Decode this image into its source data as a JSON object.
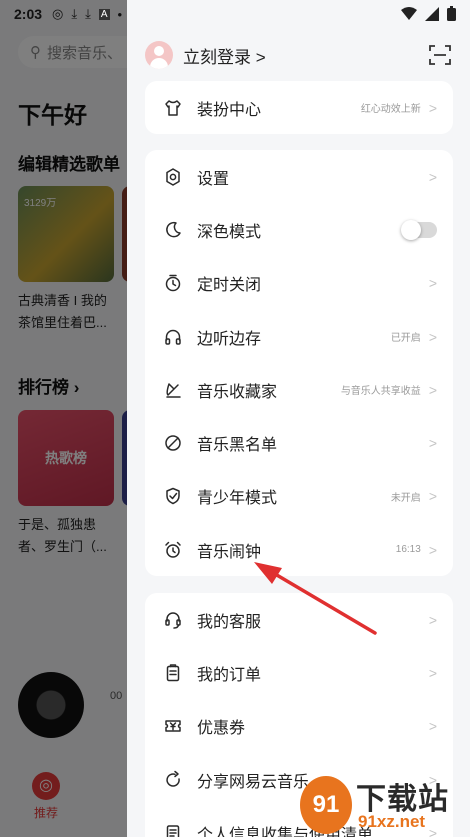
{
  "status_bar": {
    "time": "2:03",
    "left_icons": [
      "netease-icon",
      "download-icon",
      "download-icon",
      "a-icon",
      "dot-icon"
    ],
    "right_icons": [
      "wifi-icon",
      "signal-icon",
      "battery-icon"
    ]
  },
  "background": {
    "search_placeholder": "搜索音乐、",
    "greeting": "下午好",
    "section_editor": "编辑精选歌单",
    "playlist_count": "3129万",
    "playlist_caption": "古典清香 I 我的茶馆里住着巴...",
    "section_chart": "排行榜",
    "chart_badge": "热歌榜",
    "chart_caption": "于是、孤独患者、罗生门（...",
    "player_time": "00",
    "nav_label": "推荐"
  },
  "drawer": {
    "login_label": "立刻登录",
    "login_chevron": ">",
    "card1": [
      {
        "name": "dress-up",
        "icon": "shirt-icon",
        "label": "装扮中心",
        "value": "红心动效上新",
        "chevron": ">"
      }
    ],
    "card2": [
      {
        "name": "settings",
        "icon": "gear-icon",
        "label": "设置",
        "value": "",
        "chevron": ">"
      },
      {
        "name": "dark-mode",
        "icon": "moon-icon",
        "label": "深色模式",
        "value": "",
        "chevron": ""
      },
      {
        "name": "sleep-timer",
        "icon": "timer-icon",
        "label": "定时关闭",
        "value": "",
        "chevron": ">"
      },
      {
        "name": "listen-cache",
        "icon": "headphones-icon",
        "label": "边听边存",
        "value": "已开启",
        "chevron": ">"
      },
      {
        "name": "music-collector",
        "icon": "collector-icon",
        "label": "音乐收藏家",
        "value": "与音乐人共享收益",
        "chevron": ">"
      },
      {
        "name": "blacklist",
        "icon": "ban-icon",
        "label": "音乐黑名单",
        "value": "",
        "chevron": ">"
      },
      {
        "name": "teen-mode",
        "icon": "shield-icon",
        "label": "青少年模式",
        "value": "未开启",
        "chevron": ">"
      },
      {
        "name": "music-alarm",
        "icon": "alarm-icon",
        "label": "音乐闹钟",
        "value": "16:13",
        "chevron": ">"
      }
    ],
    "card3": [
      {
        "name": "customer-service",
        "icon": "headset-icon",
        "label": "我的客服",
        "value": "",
        "chevron": ">"
      },
      {
        "name": "my-orders",
        "icon": "clipboard-icon",
        "label": "我的订单",
        "value": "",
        "chevron": ">"
      },
      {
        "name": "coupons",
        "icon": "coupon-icon",
        "label": "优惠券",
        "value": "",
        "chevron": ">"
      },
      {
        "name": "share",
        "icon": "share-icon",
        "label": "分享网易云音乐",
        "value": "",
        "chevron": ">"
      },
      {
        "name": "privacy",
        "icon": "doc-icon",
        "label": "个人信息收集与使用清单",
        "value": "",
        "chevron": ">"
      }
    ],
    "dark_mode_on": false
  },
  "watermark": {
    "logo_text": "91",
    "title": "下载站",
    "url": "91xz.net"
  },
  "colors": {
    "accent_red": "#e63b3b",
    "annotation_arrow": "#e03030",
    "watermark_orange": "#e8741e"
  }
}
